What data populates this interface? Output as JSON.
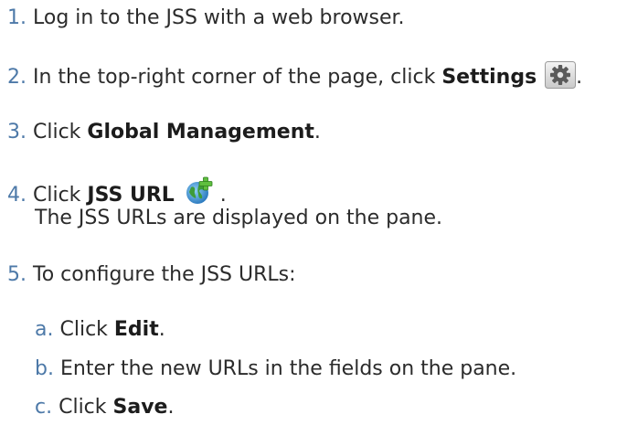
{
  "steps": [
    {
      "number": "1.",
      "text": "Log in to the JSS with a web browser."
    },
    {
      "number": "2.",
      "text_before": "In the top-right corner of the page, click ",
      "bold": "Settings",
      "text_after": "."
    },
    {
      "number": "3.",
      "text_before": "Click ",
      "bold": "Global Management",
      "text_after": "."
    },
    {
      "number": "4.",
      "text_before": "Click ",
      "bold": "JSS URL",
      "text_after": ".",
      "note": "The JSS URLs are displayed on the pane."
    },
    {
      "number": "5.",
      "text": "To configure the JSS URLs:"
    }
  ],
  "substeps": [
    {
      "letter": "a.",
      "text_before": "Click ",
      "bold": "Edit",
      "text_after": "."
    },
    {
      "letter": "b.",
      "text": "Enter the new URLs in the fields on the pane."
    },
    {
      "letter": "c.",
      "text_before": "Click ",
      "bold": "Save",
      "text_after": "."
    }
  ],
  "icons": {
    "settings": "gear-icon",
    "jss_url": "globe-plus-icon"
  },
  "colors": {
    "number": "#4d79a8",
    "text": "#2b2b2b"
  }
}
